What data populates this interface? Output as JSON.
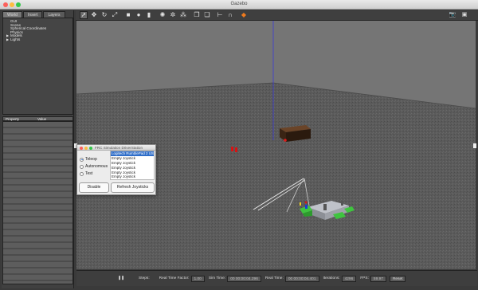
{
  "window": {
    "title": "Gazebo"
  },
  "left_panel": {
    "tabs": [
      "World",
      "Insert",
      "Layers"
    ],
    "tree": [
      {
        "label": "GUI",
        "expandable": false
      },
      {
        "label": "Scene",
        "expandable": false
      },
      {
        "label": "Spherical Coordinates",
        "expandable": false
      },
      {
        "label": "Physics",
        "expandable": false
      },
      {
        "label": "Models",
        "expandable": true
      },
      {
        "label": "Lights",
        "expandable": true
      }
    ],
    "property_header": "Property",
    "value_header": "Value"
  },
  "toolbar": {
    "tools": [
      {
        "icon": "arrow-select-icon",
        "glyph": "➚",
        "selected": true
      },
      {
        "icon": "translate-icon",
        "glyph": "✥",
        "selected": false
      },
      {
        "icon": "rotate-icon",
        "glyph": "↻",
        "selected": false
      },
      {
        "icon": "scale-icon",
        "glyph": "⤢",
        "selected": false
      },
      {
        "icon": "box-shape-icon",
        "glyph": "■",
        "selected": false
      },
      {
        "icon": "sphere-shape-icon",
        "glyph": "●",
        "selected": false
      },
      {
        "icon": "cylinder-shape-icon",
        "glyph": "▮",
        "selected": false
      },
      {
        "icon": "point-light-icon",
        "glyph": "✺",
        "selected": false
      },
      {
        "icon": "spot-light-icon",
        "glyph": "✲",
        "selected": false
      },
      {
        "icon": "directional-light-icon",
        "glyph": "⁂",
        "selected": false
      },
      {
        "icon": "copy-icon",
        "glyph": "❐",
        "selected": false
      },
      {
        "icon": "paste-icon",
        "glyph": "❏",
        "selected": false
      },
      {
        "icon": "align-icon",
        "glyph": "⊢",
        "selected": false
      },
      {
        "icon": "snap-icon",
        "glyph": "∩",
        "selected": false
      },
      {
        "icon": "change-view-icon",
        "glyph": "◆",
        "selected": false
      }
    ],
    "right_tools": [
      {
        "icon": "screenshot-icon",
        "glyph": "📷"
      },
      {
        "icon": "record-icon",
        "glyph": "▣"
      }
    ]
  },
  "driverstation": {
    "title": "FRC Simulation DriverStation",
    "modes": [
      {
        "label": "Teleop",
        "selected": true
      },
      {
        "label": "Autonomous",
        "selected": false
      },
      {
        "label": "Test",
        "selected": false
      }
    ],
    "joysticks": [
      {
        "label": "Logitech RumblePad 2 USB",
        "selected": true
      },
      {
        "label": "Empty Joystick",
        "selected": false
      },
      {
        "label": "Empty Joystick",
        "selected": false
      },
      {
        "label": "Empty Joystick",
        "selected": false
      },
      {
        "label": "Empty Joystick",
        "selected": false
      },
      {
        "label": "Empty Joystick",
        "selected": false
      }
    ],
    "disable_label": "Disable",
    "refresh_label": "Refresh Joysticks"
  },
  "status_bar": {
    "pause_glyph": "❚❚",
    "steps_label": "Steps:",
    "real_time_factor_label": "Real Time Factor:",
    "real_time_factor_value": "1.00",
    "sim_time_label": "Sim Time:",
    "sim_time_value": "00 00:00:04.296",
    "real_time_label": "Real Time:",
    "real_time_value": "00 00:00:04.401",
    "iterations_label": "Iterations:",
    "iterations_value": "4296",
    "fps_label": "FPS:",
    "fps_value": "59.97",
    "reset_label": "Reset"
  },
  "colors": {
    "floor": "#5c5c5c",
    "sky": "#777777",
    "robot_green": "#3cc43c",
    "bumper_red": "#d01818",
    "selection_blue": "#2f6ec9"
  }
}
